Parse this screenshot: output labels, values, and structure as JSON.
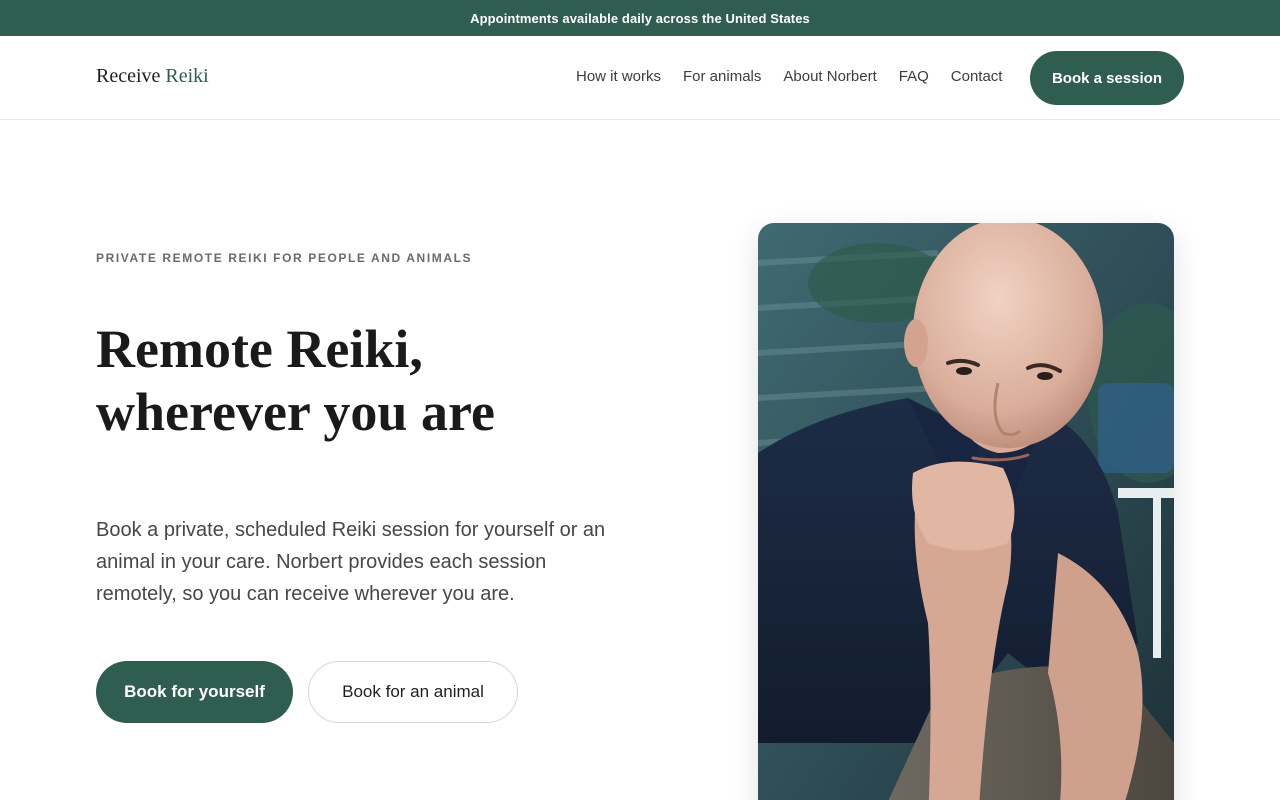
{
  "announcement": {
    "text": "Appointments available daily across the United States"
  },
  "header": {
    "logo": {
      "primary": "Receive",
      "accent": "Reiki"
    },
    "nav": [
      "How it works",
      "For animals",
      "About Norbert",
      "FAQ",
      "Contact"
    ],
    "cta_label": "Book a session"
  },
  "hero": {
    "eyebrow": "PRIVATE REMOTE REIKI FOR PEOPLE AND ANIMALS",
    "headline_line1": "Remote Reiki,",
    "headline_line2": "wherever you are",
    "lede": "Book a private, scheduled Reiki session for yourself or an animal in your care. Norbert provides each session remotely, so you can receive wherever you are.",
    "primary_cta": "Book for yourself",
    "secondary_cta": "Book for an animal"
  },
  "colors": {
    "brand": "#2f5d4f",
    "text": "#1a1a1a",
    "muted": "#474747",
    "white": "#ffffff"
  }
}
